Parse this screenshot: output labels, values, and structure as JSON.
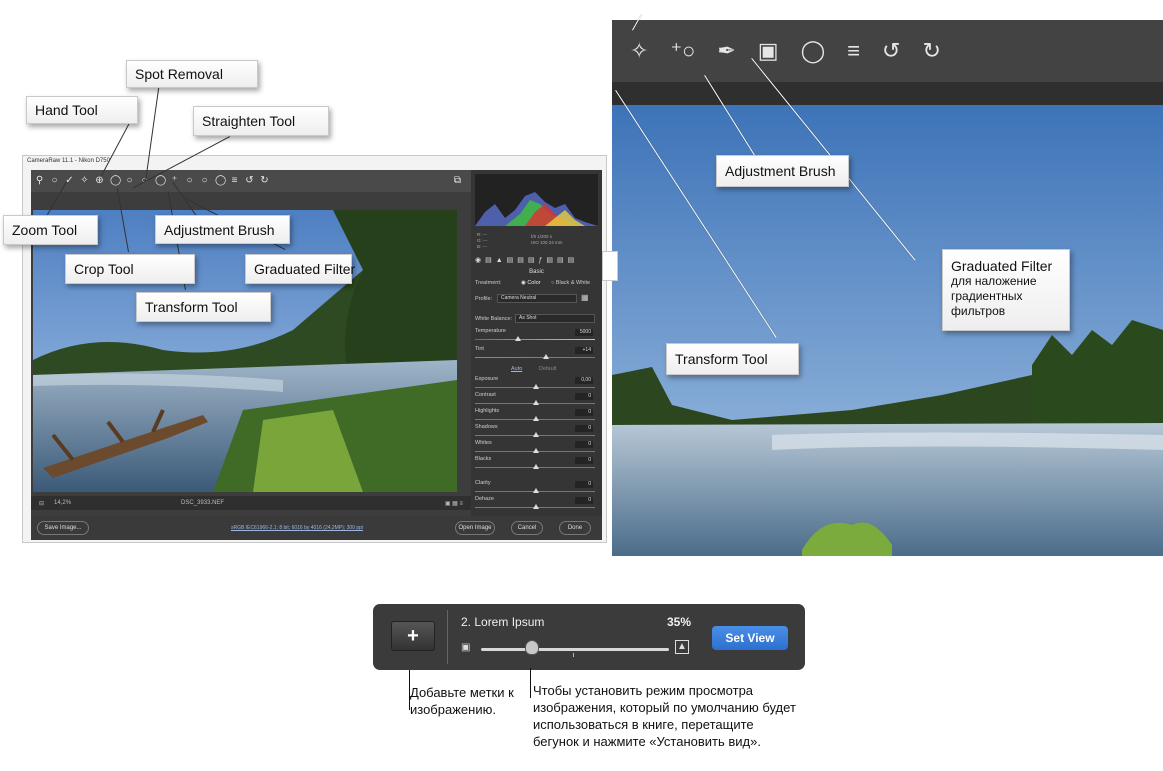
{
  "camera_raw": {
    "window_title": "CameraRaw 11.1  -  Nikon D750",
    "histogram_info": [
      "R:  ---",
      "G:  ---",
      "B:  ---"
    ],
    "camera_info": [
      "f/8   1/200 s",
      "ISO 100   24 mm"
    ],
    "panel": {
      "section": "Basic",
      "treatment_label": "Treatment:",
      "treatment_color": "Color",
      "treatment_bw": "Black & White",
      "profile_label": "Profile:",
      "profile_value": "Camera Neutral",
      "wb_label": "White Balance:",
      "wb_value": "As Shot",
      "auto": "Auto",
      "default": "Default",
      "sliders": [
        {
          "label": "Temperature",
          "value": "5000"
        },
        {
          "label": "Tint",
          "value": "+14"
        },
        {
          "label": "Exposure",
          "value": "0,00"
        },
        {
          "label": "Contrast",
          "value": "0"
        },
        {
          "label": "Highlights",
          "value": "0"
        },
        {
          "label": "Shadows",
          "value": "0"
        },
        {
          "label": "Whites",
          "value": "0"
        },
        {
          "label": "Blacks",
          "value": "0"
        },
        {
          "label": "Clarity",
          "value": "0"
        },
        {
          "label": "Dehaze",
          "value": "0"
        }
      ]
    },
    "status": {
      "zoom": "14,2%",
      "filename": "DSC_3933.NEF"
    },
    "footer": {
      "save_image": "Save Image...",
      "workflow_link": "sRGB IEC61966-2.1; 8 bit; 6016 by 4016 (24,2MP); 300 ppi",
      "open_image": "Open Image",
      "cancel": "Cancel",
      "done": "Done"
    }
  },
  "callouts_left": {
    "spot_removal": "Spot Removal",
    "hand_tool": "Hand Tool",
    "straighten_tool": "Straighten Tool",
    "zoom_tool": "Zoom Tool",
    "adjustment_brush": "Adjustment Brush",
    "crop_tool": "Crop Tool",
    "graduated_filter": "Graduated Filter",
    "transform_tool": "Transform Tool"
  },
  "callouts_right": {
    "adjustment_brush": "Adjustment Brush",
    "graduated_filter_title": "Graduated Filter",
    "graduated_filter_desc": "для наложение градиентных фильтров",
    "transform_tool": "Transform Tool"
  },
  "bottom_bar": {
    "add_symbol": "+",
    "title": "2. Lorem Ipsum",
    "percent": "35%",
    "slider_value": 0.27,
    "set_view": "Set View"
  },
  "annotations": {
    "add_marks": "Добавьте метки к изображению.",
    "set_view_help": "Чтобы установить режим просмотра изображения, который по умолчанию будет использоваться в книге, перетащите бегунок и нажмите «Установить вид»."
  },
  "colors": {
    "ui_dark": "#3d3d3d",
    "accent_blue": "#2d6fcf",
    "callout_bg": "#ffffff"
  }
}
